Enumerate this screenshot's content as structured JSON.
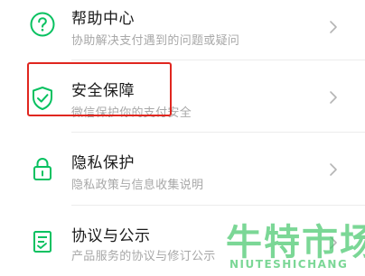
{
  "menu": {
    "items": [
      {
        "icon": "question-circle-icon",
        "title": "帮助中心",
        "subtitle": "协助解决支付遇到的问题或疑问"
      },
      {
        "icon": "shield-check-icon",
        "title": "安全保障",
        "subtitle": "微信保护你的支付安全"
      },
      {
        "icon": "lock-icon",
        "title": "隐私保护",
        "subtitle": "隐私政策与信息收集说明"
      },
      {
        "icon": "document-icon",
        "title": "协议与公示",
        "subtitle": "产品服务的协议与修订公示"
      }
    ]
  },
  "colors": {
    "accent": "#07c160",
    "highlight": "#e0261f",
    "title_text": "#1a1a1a",
    "subtitle_text": "#a8a8a8",
    "watermark": "#48c86e"
  },
  "watermark": {
    "zh": "牛特市场",
    "en": "NIUTESHICHANG"
  }
}
